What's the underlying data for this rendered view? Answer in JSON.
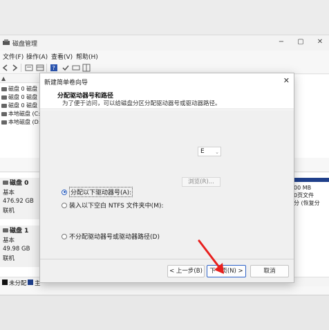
{
  "app": {
    "title": "磁盘管理",
    "menu": [
      "文件(F)",
      "操作(A)",
      "查看(V)",
      "帮助(H)"
    ]
  },
  "volumes": [
    "磁盘 0 磁盘",
    "磁盘 0 磁盘",
    "磁盘 0 磁盘",
    "本地磁盘 (C:)",
    "本地磁盘 (D:)"
  ],
  "disks": [
    {
      "name": "磁盘 0",
      "type": "基本",
      "size": "476.92 GB",
      "status": "联机",
      "right_lines": [
        "00 MB",
        "0页文件",
        "分 (恢复分"
      ]
    },
    {
      "name": "磁盘 1",
      "type": "基本",
      "size": "49.98 GB",
      "status": "联机"
    }
  ],
  "legend": [
    {
      "label": "未分配",
      "color": "#111111"
    },
    {
      "label": "主",
      "color": "#1f3f8a"
    }
  ],
  "wizard": {
    "title": "新建简单卷向导",
    "heading": "分配驱动器号和路径",
    "subheading": "为了便于访问，可以给磁盘分区分配驱动器号或驱动器路径。",
    "options": [
      {
        "label": "分配以下驱动器号(A):",
        "checked": true
      },
      {
        "label": "装入以下空白 NTFS 文件夹中(M):",
        "checked": false
      },
      {
        "label": "不分配驱动器号或驱动器路径(D)",
        "checked": false
      }
    ],
    "drive_letter": "E",
    "browse_label": "浏览(R)...",
    "buttons": {
      "back": "< 上一步(B)",
      "next": "下一页(N) >",
      "cancel": "取消"
    }
  }
}
